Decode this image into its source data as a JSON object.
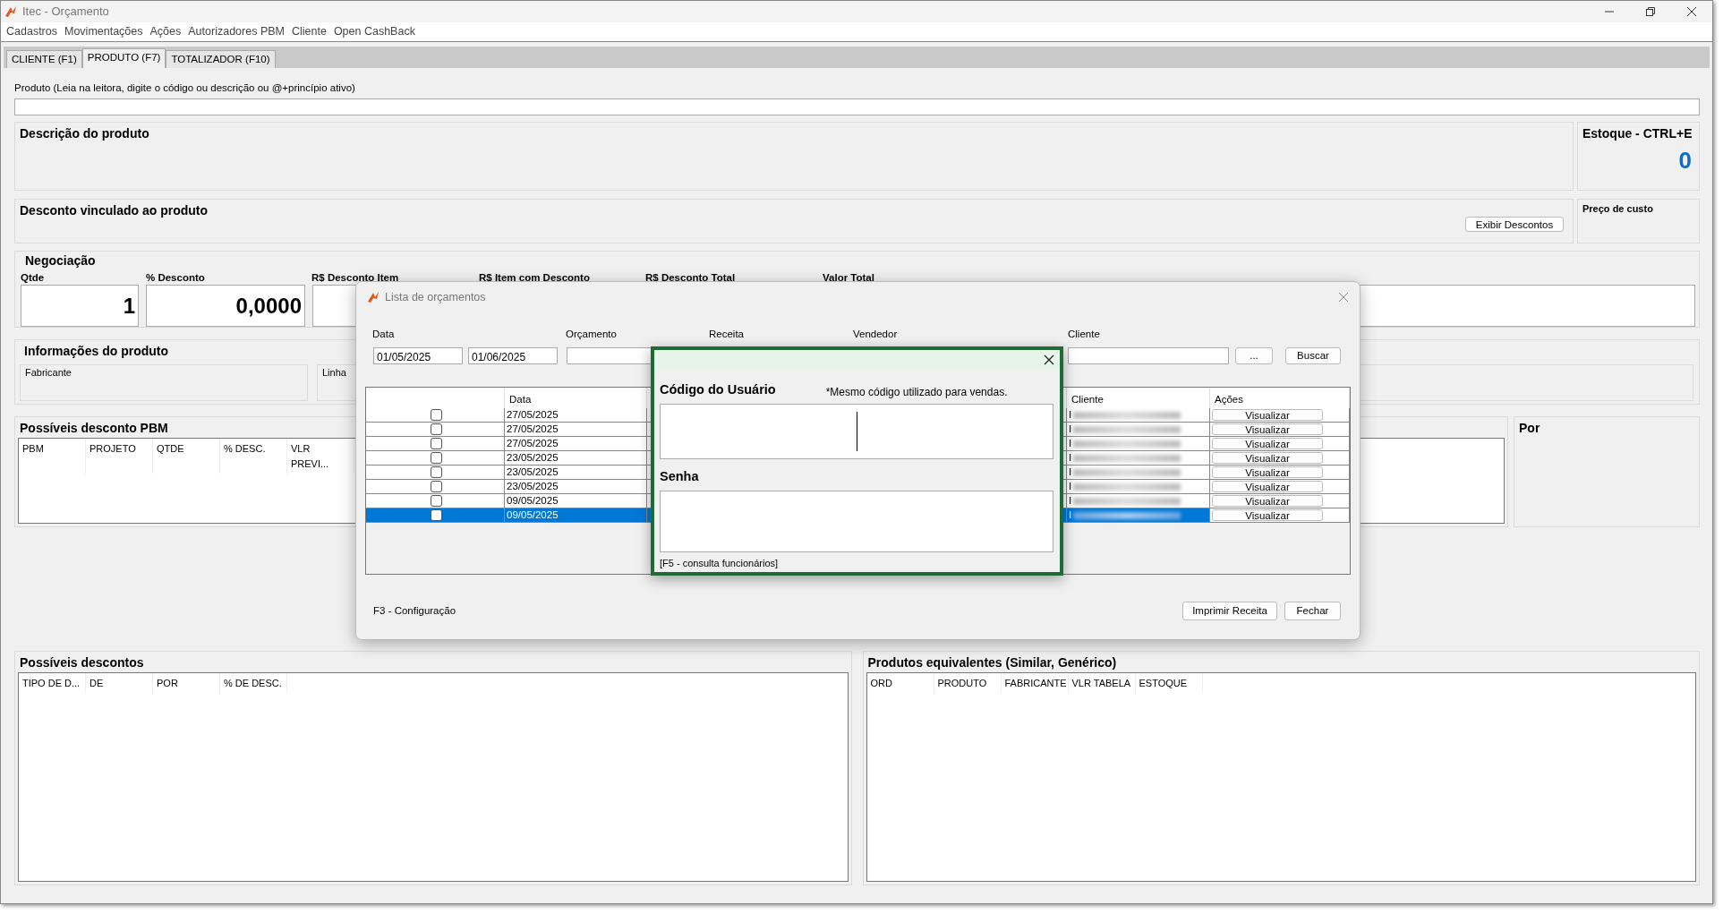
{
  "window": {
    "title": "Itec - Orçamento"
  },
  "menu": [
    "Cadastros",
    "Movimentações",
    "Ações",
    "Autorizadores PBM",
    "Cliente",
    "Open CashBack"
  ],
  "tabs": [
    {
      "label": "CLIENTE (F1)",
      "selected": false
    },
    {
      "label": "PRODUTO (F7)",
      "selected": true
    },
    {
      "label": "TOTALIZADOR (F10)",
      "selected": false
    }
  ],
  "product_search": {
    "label": "Produto (Leia na leitora, digite o código ou descrição ou @+princípio ativo)"
  },
  "description": {
    "title": "Descrição do produto"
  },
  "stock": {
    "title": "Estoque - CTRL+E",
    "value": "0"
  },
  "linked_discount": {
    "title": "Desconto vinculado ao produto",
    "button": "Exibir Descontos"
  },
  "cost_price": {
    "title": "Preço de custo"
  },
  "negotiation": {
    "title": "Negociação",
    "labels": [
      "Qtde",
      "% Desconto",
      "R$ Desconto Item",
      "R$ Item com Desconto",
      "R$ Desconto Total",
      "Valor Total"
    ],
    "qty": "1",
    "discount": "0,0000"
  },
  "product_info": {
    "title": "Informações do produto",
    "fields": [
      "Fabricante",
      "Linha"
    ]
  },
  "pbm": {
    "title": "Possíveis desconto PBM",
    "columns": [
      "PBM",
      "PROJETO",
      "QTDE",
      "% DESC.",
      "VLR PREVI..."
    ]
  },
  "por": {
    "title": "Por"
  },
  "possible_discounts": {
    "title": "Possíveis descontos",
    "columns": [
      "TIPO DE D...",
      "DE",
      "POR",
      "% DE DESC."
    ]
  },
  "equivalents": {
    "title": "Produtos equivalentes (Similar, Genérico)",
    "columns": [
      "ORD",
      "PRODUTO",
      "FABRICANTE",
      "VLR TABELA",
      "ESTOQUE"
    ]
  },
  "quotes_dialog": {
    "title": "Lista de orçamentos",
    "filter_labels": [
      "Data",
      "Orçamento",
      "Receita",
      "Vendedor",
      "Cliente"
    ],
    "date_from": "01/05/2025",
    "date_to": "01/06/2025",
    "browse_button": "...",
    "search_button": "Buscar",
    "columns": [
      "Data",
      "Cliente",
      "Ações"
    ],
    "rows": [
      {
        "date": "27/05/2025",
        "client": "I",
        "action": "Visualizar",
        "checked": false,
        "selected": false
      },
      {
        "date": "27/05/2025",
        "client": "I",
        "action": "Visualizar",
        "checked": false,
        "selected": false
      },
      {
        "date": "27/05/2025",
        "client": "I",
        "action": "Visualizar",
        "checked": false,
        "selected": false
      },
      {
        "date": "23/05/2025",
        "client": "I",
        "action": "Visualizar",
        "checked": false,
        "selected": false
      },
      {
        "date": "23/05/2025",
        "client": "I",
        "action": "Visualizar",
        "checked": false,
        "selected": false
      },
      {
        "date": "23/05/2025",
        "client": "I",
        "action": "Visualizar",
        "checked": false,
        "selected": false
      },
      {
        "date": "09/05/2025",
        "client": "I",
        "action": "Visualizar",
        "checked": false,
        "selected": false
      },
      {
        "date": "09/05/2025",
        "client": "I",
        "action": "Visualizar",
        "checked": false,
        "selected": true
      }
    ],
    "footer_hint": "F3 - Configuração",
    "buttons": [
      "Imprimir Receita",
      "Fechar"
    ]
  },
  "login": {
    "user_label": "Código do Usuário",
    "note": "*Mesmo código utilizado para vendas.",
    "password_label": "Senha",
    "hint": "[F5 - consulta funcionários]"
  }
}
